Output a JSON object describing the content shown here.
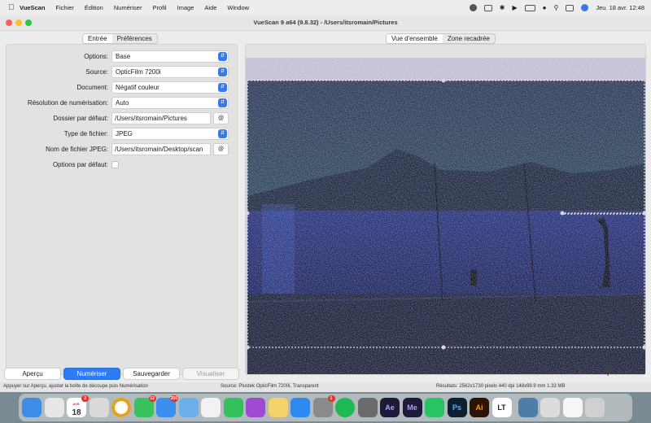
{
  "menubar": {
    "app_name": "VueScan",
    "menus": [
      "Fichier",
      "Édition",
      "Numériser",
      "Profil",
      "Image",
      "Aide",
      "Window"
    ],
    "clock": "Jeu. 18 avr.  12:48"
  },
  "window": {
    "title": "VueScan 9 a64 (9.8.32) - /Users/itsromain/Pictures"
  },
  "left_tabs": [
    "Entrée",
    "Préférences"
  ],
  "right_tabs": [
    "Vue d'ensemble",
    "Zone recadrée"
  ],
  "settings": {
    "options": {
      "label": "Options:",
      "value": "Base"
    },
    "source": {
      "label": "Source:",
      "value": "OpticFilm 7200i"
    },
    "document": {
      "label": "Document:",
      "value": "Négatif couleur"
    },
    "resolution": {
      "label": "Résolution de numérisation:",
      "value": "Auto"
    },
    "default_folder": {
      "label": "Dossier par défaut:",
      "value": "/Users/itsromain/Pictures"
    },
    "file_type": {
      "label": "Type de fichier:",
      "value": "JPEG"
    },
    "jpeg_name": {
      "label": "Nom de fichier JPEG:",
      "value": "/Users/itsromain/Desktop/scan"
    },
    "default_options": {
      "label": "Options par défaut:",
      "checked": false
    },
    "at_symbol": "@"
  },
  "buttons": {
    "preview": "Aperçu",
    "scan": "Numériser",
    "save": "Sauvegarder",
    "view": "Visualiser"
  },
  "status": {
    "hint": "Appuyer sur Aperçu, ajuster la boîte de découpe puis Numérisation",
    "source": "Source: Plustek OpticFilm 7200i, Transparent",
    "results": "Résultats: 2562x1730 pixels 440 dpi 148x99.9 mm 1.33 MB"
  },
  "dock": {
    "calendar_month": "AVR.",
    "calendar_day": "18",
    "badges": {
      "calendar": "3",
      "messages": "12",
      "mail": "350",
      "settings": "1"
    },
    "app_labels": {
      "after_effects": "Ae",
      "media_encoder": "Me",
      "photoshop": "Ps",
      "illustrator": "Ai",
      "lt": "LT"
    }
  },
  "colors": {
    "accent": "#2f7bf0"
  }
}
